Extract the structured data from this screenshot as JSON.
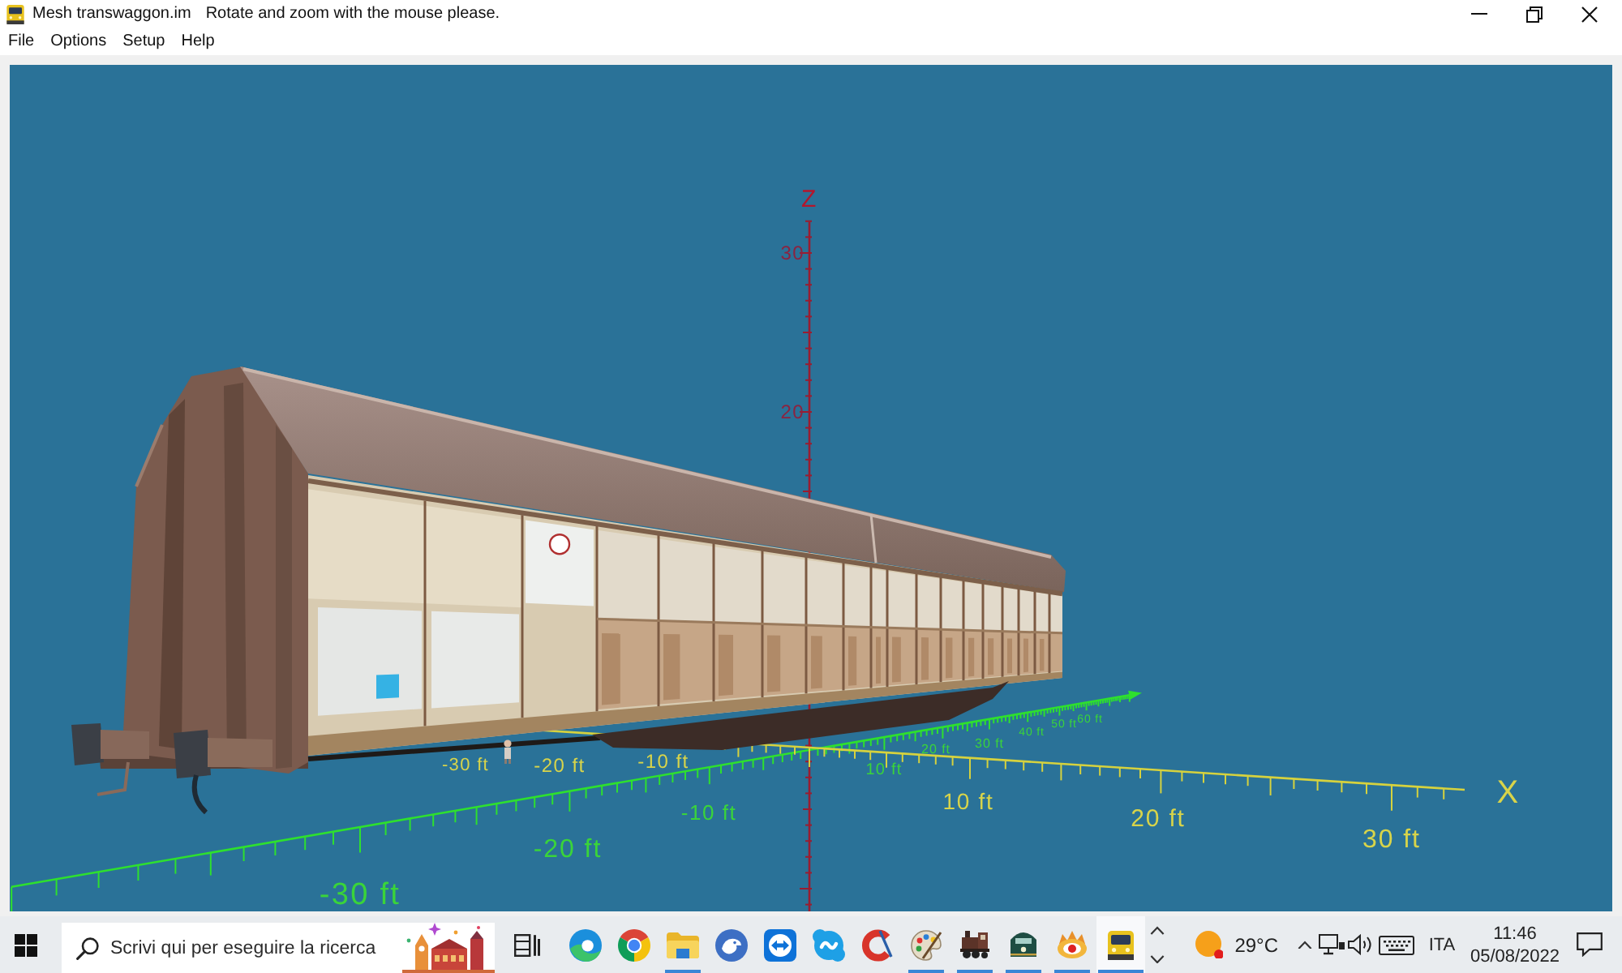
{
  "window": {
    "title": "Mesh transwaggon.im",
    "hint": "Rotate and zoom with the mouse please."
  },
  "menu": [
    {
      "label": "File"
    },
    {
      "label": "Options"
    },
    {
      "label": "Setup"
    },
    {
      "label": "Help"
    }
  ],
  "viewport": {
    "z_axis": {
      "label": "Z",
      "tick_labels": [
        "30",
        "20"
      ]
    },
    "x_axis": {
      "label": "X",
      "tick_labels": [
        "-30 ft",
        "-20 ft",
        "-10 ft",
        "10 ft",
        "20 ft",
        "30 ft"
      ]
    },
    "y_axis": {
      "tick_labels": [
        "-30 ft",
        "-20 ft",
        "-10 ft",
        "10 ft",
        "20 ft",
        "30 ft",
        "40 ft",
        "50 ft",
        "60 ft"
      ]
    }
  },
  "taskbar": {
    "search": {
      "placeholder": "Scrivi qui per eseguire la ricerca"
    },
    "apps": [
      {
        "kind": "swirl",
        "running": false,
        "selected": false
      },
      {
        "kind": "ring",
        "running": false,
        "selected": false
      },
      {
        "kind": "folder",
        "running": true,
        "selected": false
      },
      {
        "kind": "bird",
        "running": false,
        "selected": false
      },
      {
        "kind": "double_arrow",
        "running": false,
        "selected": false
      },
      {
        "kind": "bubble",
        "running": false,
        "selected": false
      },
      {
        "kind": "crescent",
        "running": false,
        "selected": false
      },
      {
        "kind": "palette",
        "running": true,
        "selected": false
      },
      {
        "kind": "steam_engine",
        "running": true,
        "selected": false
      },
      {
        "kind": "engine_front",
        "running": true,
        "selected": false
      },
      {
        "kind": "eye",
        "running": true,
        "selected": false
      },
      {
        "kind": "train",
        "running": true,
        "selected": true
      }
    ],
    "weather": {
      "temperature": "29°C"
    },
    "language": "ITA",
    "time": "11:46",
    "date": "05/08/2022"
  }
}
